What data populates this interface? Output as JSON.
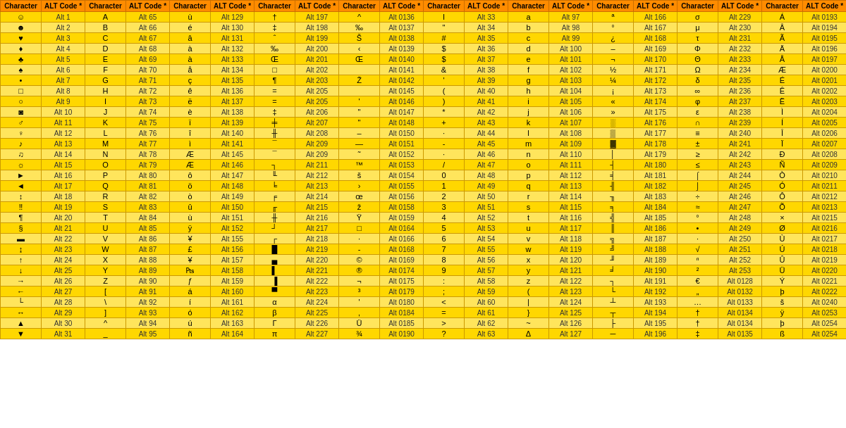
{
  "rows": [
    [
      "☺",
      "Alt 1",
      "A",
      "Alt 65",
      "ù",
      "Alt 129",
      "†",
      "Alt 197",
      "^",
      "Alt 0136",
      "I",
      "Alt 33",
      "a",
      "Alt 97",
      "ª",
      "Alt 166",
      "σ",
      "Alt 229",
      "Á",
      "Alt 0193"
    ],
    [
      "☻",
      "Alt 2",
      "B",
      "Alt 66",
      "é",
      "Alt 130",
      "‡",
      "Alt 198",
      "‰",
      "Alt 0137",
      "\"",
      "Alt 34",
      "b",
      "Alt 98",
      "°",
      "Alt 167",
      "μ",
      "Alt 230",
      "Â",
      "Alt 0194"
    ],
    [
      "♥",
      "Alt 3",
      "C",
      "Alt 67",
      "â",
      "Alt 131",
      "ˆ",
      "Alt 199",
      "Š",
      "Alt 0138",
      "#",
      "Alt 35",
      "c",
      "Alt 99",
      "¿",
      "Alt 168",
      "τ",
      "Alt 231",
      "Ã",
      "Alt 0195"
    ],
    [
      "♦",
      "Alt 4",
      "D",
      "Alt 68",
      "à",
      "Alt 132",
      "‰",
      "Alt 200",
      "‹",
      "Alt 0139",
      "$",
      "Alt 36",
      "d",
      "Alt 100",
      "–",
      "Alt 169",
      "Φ",
      "Alt 232",
      "Ä",
      "Alt 0196"
    ],
    [
      "♣",
      "Alt 5",
      "E",
      "Alt 69",
      "à",
      "Alt 133",
      "Œ",
      "Alt 201",
      "Œ",
      "Alt 0140",
      "$",
      "Alt 37",
      "e",
      "Alt 101",
      "¬",
      "Alt 170",
      "Θ",
      "Alt 233",
      "Å",
      "Alt 0197"
    ],
    [
      "♠",
      "Alt 6",
      "F",
      "Alt 70",
      "å",
      "Alt 134",
      "□",
      "Alt 202",
      "‌",
      "Alt 0141",
      "&",
      "Alt 38",
      "f",
      "Alt 102",
      "½",
      "Alt 171",
      "Ω",
      "Alt 234",
      "Æ",
      "Alt 0200"
    ],
    [
      "•",
      "Alt 7",
      "G",
      "Alt 71",
      "ç",
      "Alt 135",
      "¶",
      "Alt 203",
      "Ž",
      "Alt 0142",
      "'",
      "Alt 39",
      "g",
      "Alt 103",
      "¼",
      "Alt 172",
      "δ",
      "Alt 235",
      "É",
      "Alt 0201"
    ],
    [
      "□",
      "Alt 8",
      "H",
      "Alt 72",
      "ê",
      "Alt 136",
      "=",
      "Alt 205",
      "‍",
      "Alt 0145",
      "(",
      "Alt 40",
      "h",
      "Alt 104",
      "¡",
      "Alt 173",
      "∞",
      "Alt 236",
      "Ê",
      "Alt 0202"
    ],
    [
      "○",
      "Alt 9",
      "I",
      "Alt 73",
      "ë",
      "Alt 137",
      "=",
      "Alt 205",
      "'",
      "Alt 0146",
      ")",
      "Alt 41",
      "i",
      "Alt 105",
      "«",
      "Alt 174",
      "φ",
      "Alt 237",
      "Ë",
      "Alt 0203"
    ],
    [
      "◙",
      "Alt 10",
      "J",
      "Alt 74",
      "è",
      "Alt 138",
      "‡",
      "Alt 206",
      "\"",
      "Alt 0147",
      "*",
      "Alt 42",
      "j",
      "Alt 106",
      "»",
      "Alt 175",
      "ε",
      "Alt 238",
      "Ì",
      "Alt 0204"
    ],
    [
      "♂",
      "Alt 11",
      "K",
      "Alt 75",
      "ï",
      "Alt 139",
      "╪",
      "Alt 207",
      "\"",
      "Alt 0148",
      "+",
      "Alt 43",
      "k",
      "Alt 107",
      "░",
      "Alt 176",
      "∩",
      "Alt 239",
      "Í",
      "Alt 0205"
    ],
    [
      "♀",
      "Alt 12",
      "L",
      "Alt 76",
      "î",
      "Alt 140",
      "╫",
      "Alt 208",
      "–",
      "Alt 0150",
      "·",
      "Alt 44",
      "l",
      "Alt 108",
      "▒",
      "Alt 177",
      "≡",
      "Alt 240",
      "Î",
      "Alt 0206"
    ],
    [
      "♪",
      "Alt 13",
      "M",
      "Alt 77",
      "ì",
      "Alt 141",
      "¯",
      "Alt 209",
      "—",
      "Alt 0151",
      "-",
      "Alt 45",
      "m",
      "Alt 109",
      "▓",
      "Alt 178",
      "±",
      "Alt 241",
      "Ï",
      "Alt 0207"
    ],
    [
      "♫",
      "Alt 14",
      "N",
      "Alt 78",
      "Æ",
      "Alt 145",
      "¯",
      "Alt 209",
      "˜",
      "Alt 0152",
      "·",
      "Alt 46",
      "n",
      "Alt 110",
      "│",
      "Alt 179",
      "≥",
      "Alt 242",
      "Ð",
      "Alt 0208"
    ],
    [
      "☼",
      "Alt 15",
      "O",
      "Alt 79",
      "Æ",
      "Alt 146",
      "┐",
      "Alt 211",
      "™",
      "Alt 0153",
      "/",
      "Alt 47",
      "o",
      "Alt 111",
      "┤",
      "Alt 180",
      "≤",
      "Alt 243",
      "Ñ",
      "Alt 0209"
    ],
    [
      "►",
      "Alt 16",
      "P",
      "Alt 80",
      "ô",
      "Alt 147",
      "╙",
      "Alt 212",
      "š",
      "Alt 0154",
      "0",
      "Alt 48",
      "p",
      "Alt 112",
      "╡",
      "Alt 181",
      "⌠",
      "Alt 244",
      "Ò",
      "Alt 0210"
    ],
    [
      "◄",
      "Alt 17",
      "Q",
      "Alt 81",
      "ö",
      "Alt 148",
      "╘",
      "Alt 213",
      "›",
      "Alt 0155",
      "1",
      "Alt 49",
      "q",
      "Alt 113",
      "╢",
      "Alt 182",
      "⌡",
      "Alt 245",
      "Ó",
      "Alt 0211"
    ],
    [
      "↕",
      "Alt 18",
      "R",
      "Alt 82",
      "ò",
      "Alt 149",
      "╒",
      "Alt 214",
      "œ",
      "Alt 0156",
      "2",
      "Alt 50",
      "r",
      "Alt 114",
      "╖",
      "Alt 183",
      "÷",
      "Alt 246",
      "Ô",
      "Alt 0212"
    ],
    [
      "‼",
      "Alt 19",
      "S",
      "Alt 83",
      "û",
      "Alt 150",
      "╓",
      "Alt 215",
      "ž",
      "Alt 0158",
      "3",
      "Alt 51",
      "s",
      "Alt 115",
      "╕",
      "Alt 184",
      "≈",
      "Alt 247",
      "Õ",
      "Alt 0213"
    ],
    [
      "¶",
      "Alt 20",
      "T",
      "Alt 84",
      "ù",
      "Alt 151",
      "╫",
      "Alt 216",
      "Ÿ",
      "Alt 0159",
      "4",
      "Alt 52",
      "t",
      "Alt 116",
      "╣",
      "Alt 185",
      "°",
      "Alt 248",
      "×",
      "Alt 0215"
    ],
    [
      "§",
      "Alt 21",
      "U",
      "Alt 85",
      "ÿ",
      "Alt 152",
      "┘",
      "Alt 217",
      "□",
      "Alt 0164",
      "5",
      "Alt 53",
      "u",
      "Alt 117",
      "║",
      "Alt 186",
      "•",
      "Alt 249",
      "Ø",
      "Alt 0216"
    ],
    [
      "▬",
      "Alt 22",
      "V",
      "Alt 86",
      "¥",
      "Alt 155",
      "┌",
      "Alt 218",
      "·",
      "Alt 0166",
      "6",
      "Alt 54",
      "v",
      "Alt 118",
      "╗",
      "Alt 187",
      "·",
      "Alt 250",
      "Ù",
      "Alt 0217"
    ],
    [
      "↨",
      "Alt 23",
      "W",
      "Alt 87",
      "£",
      "Alt 156",
      "█",
      "Alt 219",
      "-",
      "Alt 0168",
      "7",
      "Alt 55",
      "w",
      "Alt 119",
      "╝",
      "Alt 188",
      "√",
      "Alt 251",
      "Ú",
      "Alt 0218"
    ],
    [
      "↑",
      "Alt 24",
      "X",
      "Alt 88",
      "¥",
      "Alt 157",
      "▄",
      "Alt 220",
      "©",
      "Alt 0169",
      "8",
      "Alt 56",
      "x",
      "Alt 120",
      "╜",
      "Alt 189",
      "ⁿ",
      "Alt 252",
      "Û",
      "Alt 0219"
    ],
    [
      "↓",
      "Alt 25",
      "Y",
      "Alt 89",
      "₧",
      "Alt 158",
      "▌",
      "Alt 221",
      "®",
      "Alt 0174",
      "9",
      "Alt 57",
      "y",
      "Alt 121",
      "╛",
      "Alt 190",
      "²",
      "Alt 253",
      "Ü",
      "Alt 0220"
    ],
    [
      "→",
      "Alt 26",
      "Z",
      "Alt 90",
      "ƒ",
      "Alt 159",
      "▐",
      "Alt 222",
      "¬",
      "Alt 0175",
      ":",
      "Alt 58",
      "z",
      "Alt 122",
      "┐",
      "Alt 191",
      "€",
      "Alt 0128",
      "Ý",
      "Alt 0221"
    ],
    [
      "←",
      "Alt 27",
      "[",
      "Alt 91",
      "á",
      "Alt 160",
      "▀",
      "Alt 223",
      "³",
      "Alt 0179",
      ";",
      "Alt 59",
      "(",
      "Alt 123",
      "└",
      "Alt 192",
      "„",
      "Alt 0132",
      "þ",
      "Alt 0222"
    ],
    [
      "└",
      "Alt 28",
      "\\",
      "Alt 92",
      "í",
      "Alt 161",
      "α",
      "Alt 224",
      "'",
      "Alt 0180",
      "<",
      "Alt 60",
      "|",
      "Alt 124",
      "┴",
      "Alt 193",
      "…",
      "Alt 0133",
      "š",
      "Alt 0240"
    ],
    [
      "↔",
      "Alt 29",
      "]",
      "Alt 93",
      "ó",
      "Alt 162",
      "β",
      "Alt 225",
      "‚",
      "Alt 0184",
      "=",
      "Alt 61",
      "}",
      "Alt 125",
      "┬",
      "Alt 194",
      "†",
      "Alt 0134",
      "ÿ",
      "Alt 0253"
    ],
    [
      "▲",
      "Alt 30",
      "^",
      "Alt 94",
      "ú",
      "Alt 163",
      "Γ",
      "Alt 226",
      "Ü",
      "Alt 0185",
      ">",
      "Alt 62",
      "~",
      "Alt 126",
      "├",
      "Alt 195",
      "†",
      "Alt 0134",
      "þ",
      "Alt 0254"
    ],
    [
      "▼",
      "Alt 31",
      "_",
      "Alt 95",
      "ñ",
      "Alt 164",
      "π",
      "Alt 227",
      "¾",
      "Alt 0190",
      "?",
      "Alt 63",
      "Δ",
      "Alt 127",
      "─",
      "Alt 196",
      "‡",
      "Alt 0135",
      "ß",
      "Alt 0254"
    ]
  ]
}
